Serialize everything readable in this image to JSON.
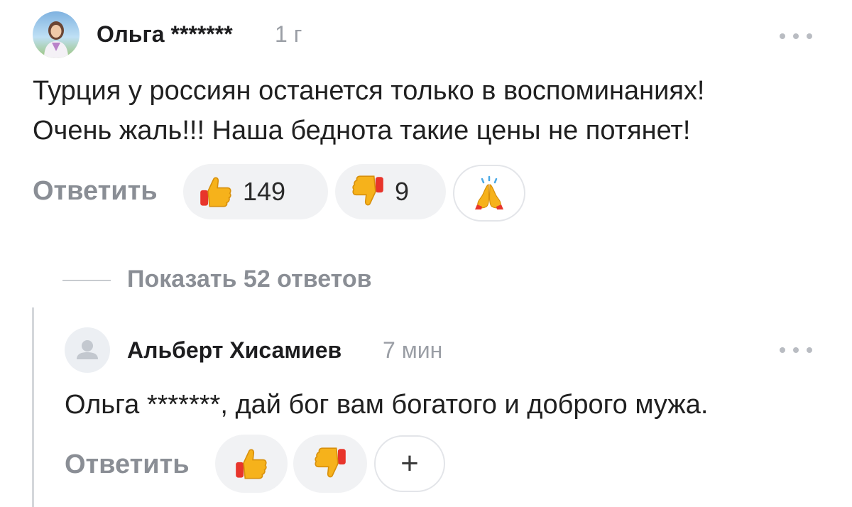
{
  "comment": {
    "author": "Ольга *******",
    "time": "1 г",
    "text_line1": "Турция у россиян останется только в воспоминаниях!",
    "text_line2": "Очень жаль!!! Наша беднота такие цены не потянет!",
    "reply_label": "Ответить",
    "likes": "149",
    "dislikes": "9"
  },
  "show_replies": "Показать 52 ответов",
  "reply": {
    "author": "Альберт Хисамиев",
    "time": "7 мин",
    "text": "Ольга *******, дай бог вам богатого и доброго мужа.",
    "reply_label": "Ответить",
    "plus": "+"
  },
  "icons": {
    "like": "thumbs-up-icon",
    "dislike": "thumbs-down-icon",
    "pray": "pray-hands-icon",
    "more": "more-dots-icon",
    "avatar_placeholder": "user-silhouette-icon"
  },
  "colors": {
    "meta_gray": "#9a9ea5",
    "button_gray": "#8a8e95",
    "pill_bg": "#f1f2f4",
    "emoji_yellow": "#f6b21b",
    "emoji_red": "#e8352b"
  }
}
